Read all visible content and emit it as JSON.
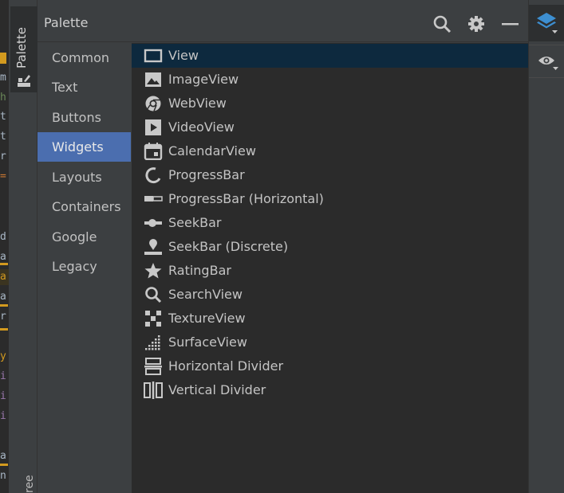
{
  "code_chars": [
    "m",
    "h",
    "t",
    "t",
    "r",
    "=",
    "d",
    "a",
    "a",
    "a",
    "r",
    "y",
    "i",
    "i",
    "i",
    "a",
    "n"
  ],
  "tool_strip": {
    "palette_tab": "Palette",
    "tree_tab": "ree"
  },
  "palette": {
    "title": "Palette",
    "categories": [
      {
        "label": "Common"
      },
      {
        "label": "Text"
      },
      {
        "label": "Buttons"
      },
      {
        "label": "Widgets"
      },
      {
        "label": "Layouts"
      },
      {
        "label": "Containers"
      },
      {
        "label": "Google"
      },
      {
        "label": "Legacy"
      }
    ],
    "selected_category": "Widgets",
    "widgets": [
      {
        "label": "View",
        "icon": "view-icon"
      },
      {
        "label": "ImageView",
        "icon": "image-view-icon"
      },
      {
        "label": "WebView",
        "icon": "web-view-icon"
      },
      {
        "label": "VideoView",
        "icon": "video-view-icon"
      },
      {
        "label": "CalendarView",
        "icon": "calendar-view-icon"
      },
      {
        "label": "ProgressBar",
        "icon": "progress-bar-icon"
      },
      {
        "label": "ProgressBar (Horizontal)",
        "icon": "progress-bar-horizontal-icon"
      },
      {
        "label": "SeekBar",
        "icon": "seek-bar-icon"
      },
      {
        "label": "SeekBar (Discrete)",
        "icon": "seek-bar-discrete-icon"
      },
      {
        "label": "RatingBar",
        "icon": "rating-bar-icon"
      },
      {
        "label": "SearchView",
        "icon": "search-view-icon"
      },
      {
        "label": "TextureView",
        "icon": "texture-view-icon"
      },
      {
        "label": "SurfaceView",
        "icon": "surface-view-icon"
      },
      {
        "label": "Horizontal Divider",
        "icon": "horizontal-divider-icon"
      },
      {
        "label": "Vertical Divider",
        "icon": "vertical-divider-icon"
      }
    ],
    "selected_widget": "View"
  },
  "colors": {
    "selected_category_bg": "#4b6eaf",
    "selected_widget_bg": "#0d293e",
    "accent_blue": "#3d8fd1",
    "code_marker": "#d39a1f"
  }
}
